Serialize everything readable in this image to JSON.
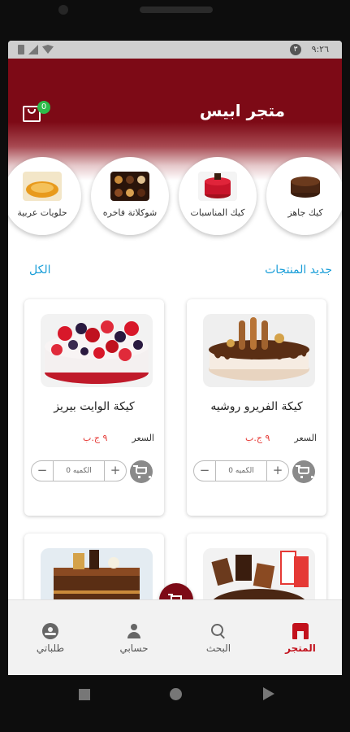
{
  "status_bar": {
    "time": "٩:٢٦",
    "badge": "٣"
  },
  "header": {
    "title": "متجر ابيس",
    "cart_badge": "0"
  },
  "categories": [
    {
      "label": "كيك جاهز"
    },
    {
      "label": "كيك المناسبات"
    },
    {
      "label": "شوكلاتة فاخره"
    },
    {
      "label": "حلويات عربية"
    }
  ],
  "section": {
    "title": "جديد المنتجات",
    "see_all": "الكل"
  },
  "products": [
    {
      "name": "كيكة الفريرو روشيه",
      "price_label": "السعر",
      "price": "٩ ج.ب",
      "qty_placeholder": "الكميه 0"
    },
    {
      "name": "كيكة الوايت بيريز",
      "price_label": "السعر",
      "price": "٩ ج.ب",
      "qty_placeholder": "الكميه 0"
    }
  ],
  "bottom_nav": [
    {
      "label": "المتجر"
    },
    {
      "label": "البحث"
    },
    {
      "label": "حسابي"
    },
    {
      "label": "طلباتي"
    }
  ],
  "colors": {
    "brand": "#7d0a16",
    "accent": "#1a9ed8",
    "price": "#e53935",
    "active_nav": "#c2111c"
  }
}
